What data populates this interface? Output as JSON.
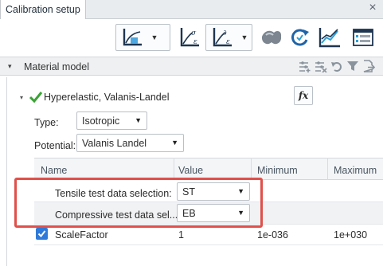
{
  "window": {
    "tab_title": "Calibration setup",
    "close_glyph": "×"
  },
  "toolbar": {
    "icons": [
      "chart-plot-icon",
      "stress-strain-icon",
      "stress-strain-delta-icon",
      "material-shape-icon",
      "refresh-icon",
      "trend-chart-icon",
      "form-panel-icon"
    ]
  },
  "section": {
    "caret": "▾",
    "title": "Material model",
    "icons": [
      "sliders-add-icon",
      "sliders-remove-icon",
      "undo-icon",
      "filter-icon",
      "export-icon"
    ]
  },
  "model": {
    "caret": "▾",
    "name": "Hyperelastic, Valanis-Landel",
    "fx_label": "fx",
    "type_label": "Type:",
    "type_value": "Isotropic",
    "potential_label": "Potential:",
    "potential_value": "Valanis Landel"
  },
  "table": {
    "headers": [
      "Name",
      "Value",
      "Minimum",
      "Maximum"
    ],
    "rows": [
      {
        "name": "Tensile test data selection:",
        "value": "ST",
        "minimum": "",
        "maximum": ""
      },
      {
        "name": "Compressive test data sel...",
        "value": "EB",
        "minimum": "",
        "maximum": ""
      },
      {
        "name": "ScaleFactor",
        "value": "1",
        "minimum": "1e-036",
        "maximum": "1e+030",
        "checked": true
      }
    ]
  },
  "colors": {
    "accent": "#2f7ad9",
    "highlight": "#e0504a",
    "check": "#3aa335"
  }
}
